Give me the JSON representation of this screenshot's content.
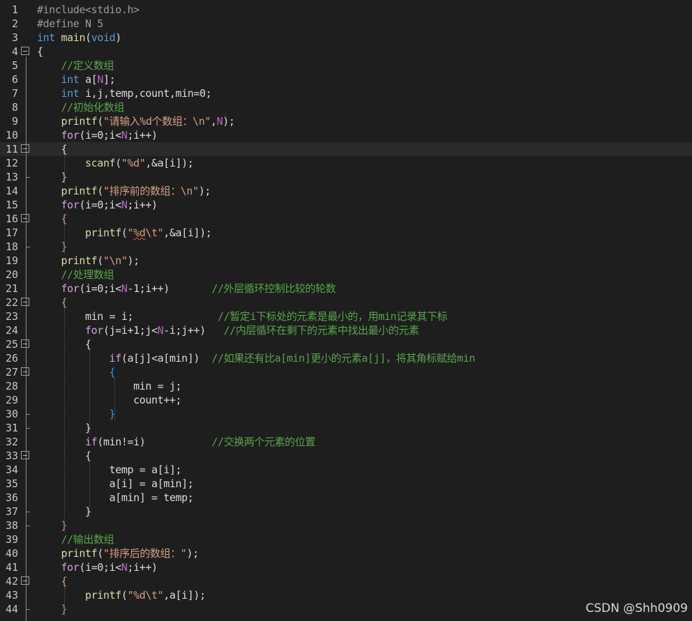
{
  "watermark": "CSDN @Shh0909",
  "lines": [
    {
      "n": "1",
      "fold": "",
      "tokens": [
        [
          "pp",
          "#include<stdio.h>"
        ]
      ]
    },
    {
      "n": "2",
      "fold": "",
      "tokens": [
        [
          "pp",
          "#define N 5"
        ]
      ]
    },
    {
      "n": "3",
      "fold": "",
      "tokens": [
        [
          "kw",
          "int"
        ],
        [
          "txt",
          " "
        ],
        [
          "fn",
          "main"
        ],
        [
          "txt",
          "("
        ],
        [
          "kw",
          "void"
        ],
        [
          "txt",
          ")"
        ]
      ]
    },
    {
      "n": "4",
      "fold": "open",
      "tokens": [
        [
          "txt",
          "{"
        ]
      ]
    },
    {
      "n": "5",
      "fold": "",
      "tokens": [
        [
          "txt",
          "    "
        ],
        [
          "cm",
          "//定义数组"
        ]
      ]
    },
    {
      "n": "6",
      "fold": "",
      "tokens": [
        [
          "txt",
          "    "
        ],
        [
          "kw",
          "int"
        ],
        [
          "txt",
          " a["
        ],
        [
          "mc",
          "N"
        ],
        [
          "txt",
          "];"
        ]
      ]
    },
    {
      "n": "7",
      "fold": "",
      "tokens": [
        [
          "txt",
          "    "
        ],
        [
          "kw",
          "int"
        ],
        [
          "txt",
          " i,j,temp,count,min=0;"
        ]
      ]
    },
    {
      "n": "8",
      "fold": "",
      "tokens": [
        [
          "txt",
          "    "
        ],
        [
          "cm",
          "//初始化数组"
        ]
      ]
    },
    {
      "n": "9",
      "fold": "",
      "tokens": [
        [
          "txt",
          "    "
        ],
        [
          "fn",
          "printf"
        ],
        [
          "txt",
          "("
        ],
        [
          "st",
          "\"请输入%d个数组：\\n\""
        ],
        [
          "txt",
          ","
        ],
        [
          "mc",
          "N"
        ],
        [
          "txt",
          ");"
        ]
      ]
    },
    {
      "n": "10",
      "fold": "",
      "tokens": [
        [
          "txt",
          "    "
        ],
        [
          "ctl",
          "for"
        ],
        [
          "txt",
          "(i=0;i<"
        ],
        [
          "mc",
          "N"
        ],
        [
          "txt",
          ";i++)"
        ]
      ]
    },
    {
      "n": "11",
      "fold": "open",
      "current": true,
      "tokens": [
        [
          "txt",
          "    "
        ],
        [
          "txt",
          "{"
        ]
      ]
    },
    {
      "n": "12",
      "fold": "",
      "tokens": [
        [
          "txt",
          "        "
        ],
        [
          "fn",
          "scanf"
        ],
        [
          "txt",
          "("
        ],
        [
          "st",
          "\"%d\""
        ],
        [
          "txt",
          ",&a[i]);"
        ]
      ]
    },
    {
      "n": "13",
      "fold": "end",
      "tokens": [
        [
          "txt",
          "    "
        ],
        [
          "txt",
          "}"
        ]
      ]
    },
    {
      "n": "14",
      "fold": "",
      "tokens": [
        [
          "txt",
          "    "
        ],
        [
          "fn",
          "printf"
        ],
        [
          "txt",
          "("
        ],
        [
          "st",
          "\"排序前的数组：\\n\""
        ],
        [
          "txt",
          ");"
        ]
      ]
    },
    {
      "n": "15",
      "fold": "",
      "tokens": [
        [
          "txt",
          "    "
        ],
        [
          "ctl",
          "for"
        ],
        [
          "txt",
          "(i=0;i<"
        ],
        [
          "mc",
          "N"
        ],
        [
          "txt",
          ";i++)"
        ]
      ]
    },
    {
      "n": "16",
      "fold": "open",
      "tokens": [
        [
          "txt",
          "    "
        ],
        [
          "st",
          "{"
        ]
      ]
    },
    {
      "n": "17",
      "fold": "",
      "tokens": [
        [
          "txt",
          "        "
        ],
        [
          "fn",
          "printf"
        ],
        [
          "txt",
          "("
        ],
        [
          "st",
          "\""
        ],
        [
          "stsq",
          "%d"
        ],
        [
          "st",
          "\\t\""
        ],
        [
          "txt",
          ",&a[i]);"
        ]
      ]
    },
    {
      "n": "18",
      "fold": "end",
      "tokens": [
        [
          "txt",
          "    "
        ],
        [
          "st",
          "}"
        ]
      ]
    },
    {
      "n": "19",
      "fold": "",
      "tokens": [
        [
          "txt",
          "    "
        ],
        [
          "fn",
          "printf"
        ],
        [
          "txt",
          "("
        ],
        [
          "st",
          "\"\\n\""
        ],
        [
          "txt",
          ");"
        ]
      ]
    },
    {
      "n": "20",
      "fold": "",
      "tokens": [
        [
          "txt",
          "    "
        ],
        [
          "cm",
          "//处理数组"
        ]
      ]
    },
    {
      "n": "21",
      "fold": "",
      "tokens": [
        [
          "txt",
          "    "
        ],
        [
          "ctl",
          "for"
        ],
        [
          "txt",
          "(i=0;i<"
        ],
        [
          "mc",
          "N"
        ],
        [
          "txt",
          "-1;i++)       "
        ],
        [
          "cm",
          "//外层循环控制比较的轮数"
        ]
      ]
    },
    {
      "n": "22",
      "fold": "open",
      "tokens": [
        [
          "txt",
          "    "
        ],
        [
          "st",
          "{"
        ]
      ]
    },
    {
      "n": "23",
      "fold": "",
      "tokens": [
        [
          "txt",
          "        min = i;              "
        ],
        [
          "cm",
          "//暂定i下标处的元素是最小的，用min记录其下标"
        ]
      ]
    },
    {
      "n": "24",
      "fold": "",
      "tokens": [
        [
          "txt",
          "        "
        ],
        [
          "ctl",
          "for"
        ],
        [
          "txt",
          "(j=i+1;j<"
        ],
        [
          "mc",
          "N"
        ],
        [
          "txt",
          "-i;j++)   "
        ],
        [
          "cm",
          "//内层循环在剩下的元素中找出最小的元素"
        ]
      ]
    },
    {
      "n": "25",
      "fold": "open",
      "tokens": [
        [
          "txt",
          "        "
        ],
        [
          "txt",
          "{"
        ]
      ]
    },
    {
      "n": "26",
      "fold": "",
      "tokens": [
        [
          "txt",
          "            "
        ],
        [
          "ctl",
          "if"
        ],
        [
          "txt",
          "(a[j]<a[min])  "
        ],
        [
          "cm",
          "//如果还有比a[min]更小的元素a[j]，将其角标赋给min"
        ]
      ]
    },
    {
      "n": "27",
      "fold": "open",
      "tokens": [
        [
          "txt",
          "            "
        ],
        [
          "var",
          "{"
        ]
      ]
    },
    {
      "n": "28",
      "fold": "",
      "tokens": [
        [
          "txt",
          "                min = j;"
        ]
      ]
    },
    {
      "n": "29",
      "fold": "",
      "tokens": [
        [
          "txt",
          "                count++;"
        ]
      ]
    },
    {
      "n": "30",
      "fold": "end",
      "tokens": [
        [
          "txt",
          "            "
        ],
        [
          "var",
          "}"
        ]
      ]
    },
    {
      "n": "31",
      "fold": "end",
      "tokens": [
        [
          "txt",
          "        "
        ],
        [
          "txt",
          "}"
        ]
      ]
    },
    {
      "n": "32",
      "fold": "",
      "tokens": [
        [
          "txt",
          "        "
        ],
        [
          "ctl",
          "if"
        ],
        [
          "txt",
          "(min!=i)           "
        ],
        [
          "cm",
          "//交换两个元素的位置"
        ]
      ]
    },
    {
      "n": "33",
      "fold": "open",
      "tokens": [
        [
          "txt",
          "        "
        ],
        [
          "txt",
          "{"
        ]
      ]
    },
    {
      "n": "34",
      "fold": "",
      "tokens": [
        [
          "txt",
          "            temp = a[i];"
        ]
      ]
    },
    {
      "n": "35",
      "fold": "",
      "tokens": [
        [
          "txt",
          "            a[i] = a[min];"
        ]
      ]
    },
    {
      "n": "36",
      "fold": "",
      "tokens": [
        [
          "txt",
          "            a[min] = temp;"
        ]
      ]
    },
    {
      "n": "37",
      "fold": "end",
      "tokens": [
        [
          "txt",
          "        "
        ],
        [
          "txt",
          "}"
        ]
      ]
    },
    {
      "n": "38",
      "fold": "end",
      "tokens": [
        [
          "txt",
          "    "
        ],
        [
          "st",
          "}"
        ]
      ]
    },
    {
      "n": "39",
      "fold": "",
      "tokens": [
        [
          "txt",
          "    "
        ],
        [
          "cm",
          "//输出数组"
        ]
      ]
    },
    {
      "n": "40",
      "fold": "",
      "tokens": [
        [
          "txt",
          "    "
        ],
        [
          "fn",
          "printf"
        ],
        [
          "txt",
          "("
        ],
        [
          "st",
          "\"排序后的数组：\""
        ],
        [
          "txt",
          ");"
        ]
      ]
    },
    {
      "n": "41",
      "fold": "",
      "tokens": [
        [
          "txt",
          "    "
        ],
        [
          "ctl",
          "for"
        ],
        [
          "txt",
          "(i=0;i<"
        ],
        [
          "mc",
          "N"
        ],
        [
          "txt",
          ";i++)"
        ]
      ]
    },
    {
      "n": "42",
      "fold": "open",
      "tokens": [
        [
          "txt",
          "    "
        ],
        [
          "st",
          "{"
        ]
      ]
    },
    {
      "n": "43",
      "fold": "",
      "tokens": [
        [
          "txt",
          "        "
        ],
        [
          "fn",
          "printf"
        ],
        [
          "txt",
          "("
        ],
        [
          "st",
          "\"%d\\t\""
        ],
        [
          "txt",
          ",a[i]);"
        ]
      ]
    },
    {
      "n": "44",
      "fold": "end",
      "tokens": [
        [
          "txt",
          "    "
        ],
        [
          "st",
          "}"
        ]
      ]
    }
  ]
}
